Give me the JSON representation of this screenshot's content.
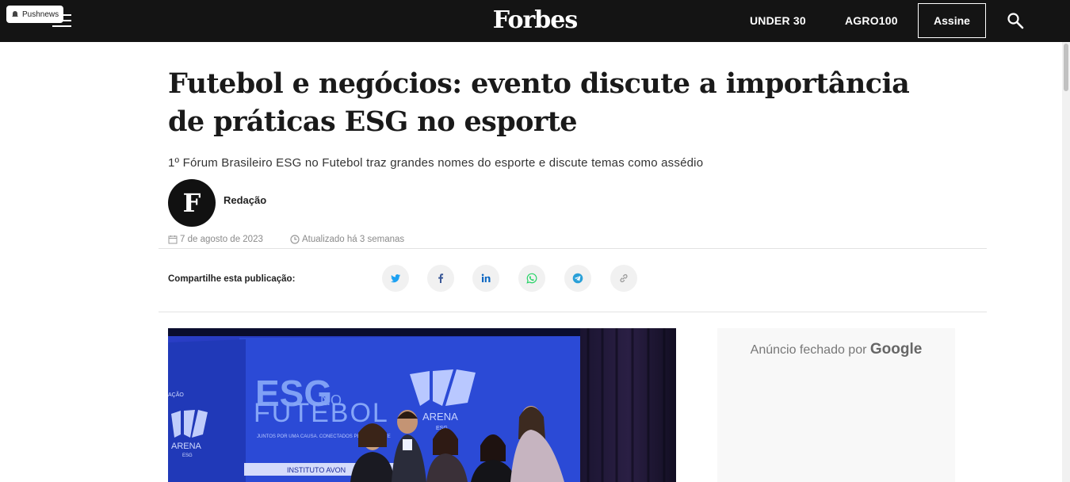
{
  "pushnews": {
    "label": "Pushnews"
  },
  "header": {
    "logo": "Forbes",
    "nav": [
      "UNDER 30",
      "AGRO100"
    ],
    "subscribe_label": "Assine"
  },
  "article": {
    "headline": "Futebol e negócios: evento discute a importância de práticas ESG no esporte",
    "dek": "1º Fórum Brasileiro ESG no Futebol traz grandes nomes do esporte e discute temas como assédio",
    "author_initial": "F",
    "author": "Redação",
    "date": "7 de agosto de 2023",
    "updated": "Atualizado há 3 semanas",
    "share_label": "Compartilhe esta publicação:",
    "share_buttons": [
      "twitter-icon",
      "facebook-icon",
      "linkedin-icon",
      "whatsapp-icon",
      "telegram-icon",
      "link-icon"
    ]
  },
  "photo": {
    "banner_esg": "ESG",
    "banner_no": "NO",
    "banner_futebol": "FUTEBOL",
    "banner_tagline": "JUNTOS POR UMA CAUSA. CONECTADOS PELO ESPORTE",
    "arena": "ARENA",
    "esg_small": "ESG",
    "side_arena": "ARENA",
    "side_esg": "ESG",
    "side_text": "AÇÃO",
    "sponsor": "INSTITUTO AVON"
  },
  "ad": {
    "closed_text": "Anúncio fechado por",
    "brand": "Google"
  },
  "colors": {
    "topbar": "#141414",
    "twitter": "#1da1f2",
    "facebook": "#3b5998",
    "linkedin": "#0a66c2",
    "whatsapp": "#25d366",
    "telegram": "#2aa0d8",
    "link": "#9a9a9a"
  }
}
